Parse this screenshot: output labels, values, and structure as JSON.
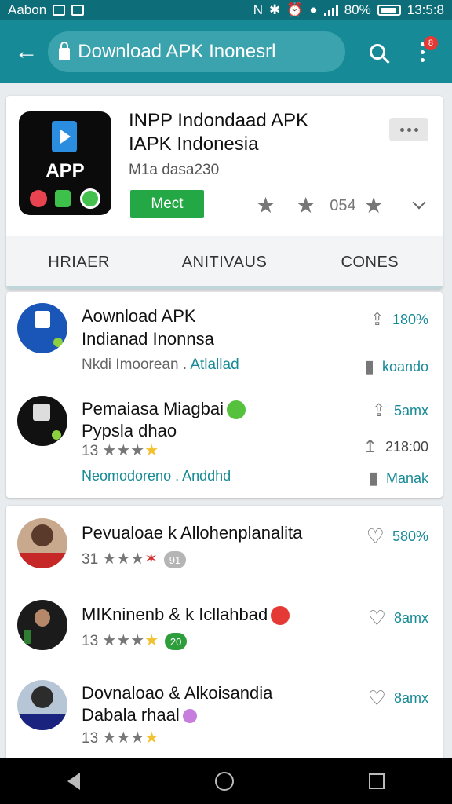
{
  "status_bar": {
    "carrier": "Aabon",
    "battery": "80%",
    "time": "13:5:8"
  },
  "app_bar": {
    "url_text": "Download APK Inonesrl",
    "notification_badge": "8"
  },
  "app": {
    "title_line1": "INPP Indondaad APK",
    "title_line2": "IAPK Indonesia",
    "subtitle": "M1a dasa230",
    "icon_label": "APP",
    "install_label": "Mect",
    "rating_text": "054"
  },
  "tabs": [
    {
      "label": "HRIAER"
    },
    {
      "label": "ANITIVAUS"
    },
    {
      "label": "CONES"
    }
  ],
  "list1": [
    {
      "title1": "Aownload APK",
      "title2": "Indianad Inonnsa",
      "sub_prefix": "Nkdi Imoorean . ",
      "link": "Atlallad",
      "meta_top": "180%",
      "meta_bottom": "koando"
    },
    {
      "title1": "Pemaiasa Miagbai",
      "title2": "Pypsla dhao",
      "rating": "13",
      "link": "Neomodoreno . Anddhd",
      "meta_top": "5amx",
      "meta_mid": "218:00",
      "meta_bottom": "Manak"
    }
  ],
  "list2": [
    {
      "title": "Pevualoae k Allohenplanalita",
      "rating": "31",
      "badge": "91",
      "likes": "580%"
    },
    {
      "title": "MIKninenb & k Icllahbad",
      "rating": "13",
      "badge": "20",
      "likes": "8amx"
    },
    {
      "title1": "Dovnaloao & Alkoisandia",
      "title2": "Dabala rhaal",
      "rating": "13",
      "likes": "8amx"
    }
  ],
  "colors": {
    "app_bar": "#168a96",
    "status_bar": "#0d6e7a",
    "install_button": "#23a845",
    "accent_text": "#178a96"
  }
}
